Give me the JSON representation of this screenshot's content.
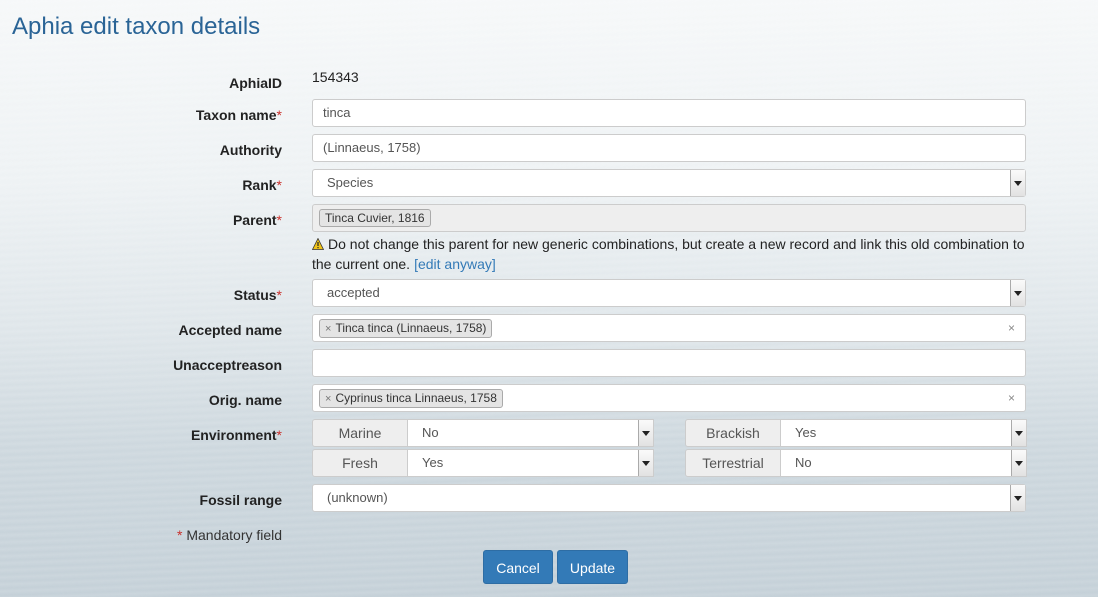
{
  "page": {
    "title": "Aphia edit taxon details"
  },
  "form": {
    "aphia_id": {
      "label": "AphiaID",
      "value": "154343"
    },
    "taxon_name": {
      "label": "Taxon name",
      "required": "*",
      "value": "tinca"
    },
    "authority": {
      "label": "Authority",
      "value": "(Linnaeus, 1758)"
    },
    "rank": {
      "label": "Rank",
      "required": "*",
      "value": "Species"
    },
    "parent": {
      "label": "Parent",
      "required": "*",
      "value": "Tinca Cuvier, 1816"
    },
    "parent_warning": {
      "text": "Do not change this parent for new generic combinations, but create a new record and link this old combination to the current one.",
      "link": "[edit anyway]"
    },
    "status": {
      "label": "Status",
      "required": "*",
      "value": "accepted"
    },
    "accepted_name": {
      "label": "Accepted name",
      "tag_remove": "×",
      "value": "Tinca tinca (Linnaeus, 1758)",
      "clear": "×"
    },
    "unacceptreason": {
      "label": "Unacceptreason",
      "value": ""
    },
    "orig_name": {
      "label": "Orig. name",
      "tag_remove": "×",
      "value": "Cyprinus tinca Linnaeus, 1758",
      "clear": "×"
    },
    "environment": {
      "label": "Environment",
      "required": "*",
      "marine": {
        "label": "Marine",
        "value": "No"
      },
      "brackish": {
        "label": "Brackish",
        "value": "Yes"
      },
      "fresh": {
        "label": "Fresh",
        "value": "Yes"
      },
      "terrestrial": {
        "label": "Terrestrial",
        "value": "No"
      }
    },
    "fossil_range": {
      "label": "Fossil range",
      "value": "(unknown)"
    },
    "mandatory_note": {
      "star": "*",
      "text": "Mandatory field"
    }
  },
  "buttons": {
    "cancel": "Cancel",
    "update": "Update"
  },
  "colors": {
    "accent": "#337ab7",
    "title": "#2a6496",
    "required": "#c9302c"
  }
}
